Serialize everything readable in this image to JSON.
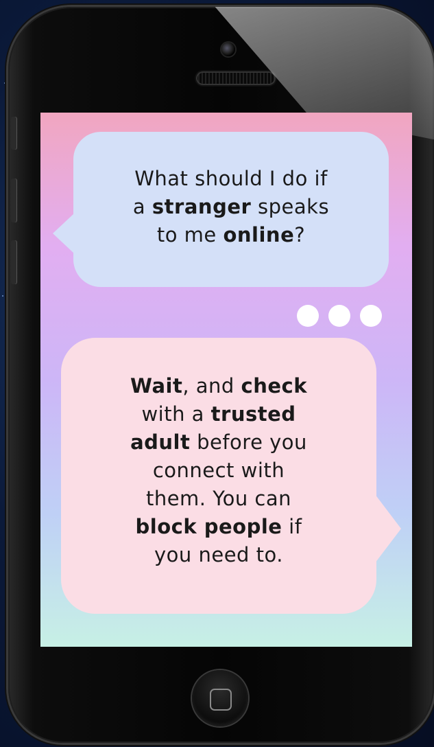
{
  "question": {
    "line1": "What should I do if",
    "line2_pre": "a ",
    "line2_bold": "stranger",
    "line2_post": " speaks",
    "line3_pre": "to me ",
    "line3_bold": "online",
    "line3_post": "?"
  },
  "answer": {
    "l1_bold": "Wait",
    "l1_mid": ", and ",
    "l1_bold2": "check",
    "l2_pre": "with a ",
    "l2_bold": "trusted",
    "l3_bold": "adult",
    "l3_post": " before you",
    "l4": "connect with",
    "l5": "them. You can",
    "l6_bold": "block people",
    "l6_post": " if",
    "l7": "you need to."
  },
  "colors": {
    "question_bubble": "#d4e0f8",
    "answer_bubble": "#fbdde5",
    "typing_dots": "#ffffff"
  },
  "icons": [
    "camera-icon",
    "speaker-icon",
    "home-button-icon",
    "typing-indicator-icon"
  ]
}
